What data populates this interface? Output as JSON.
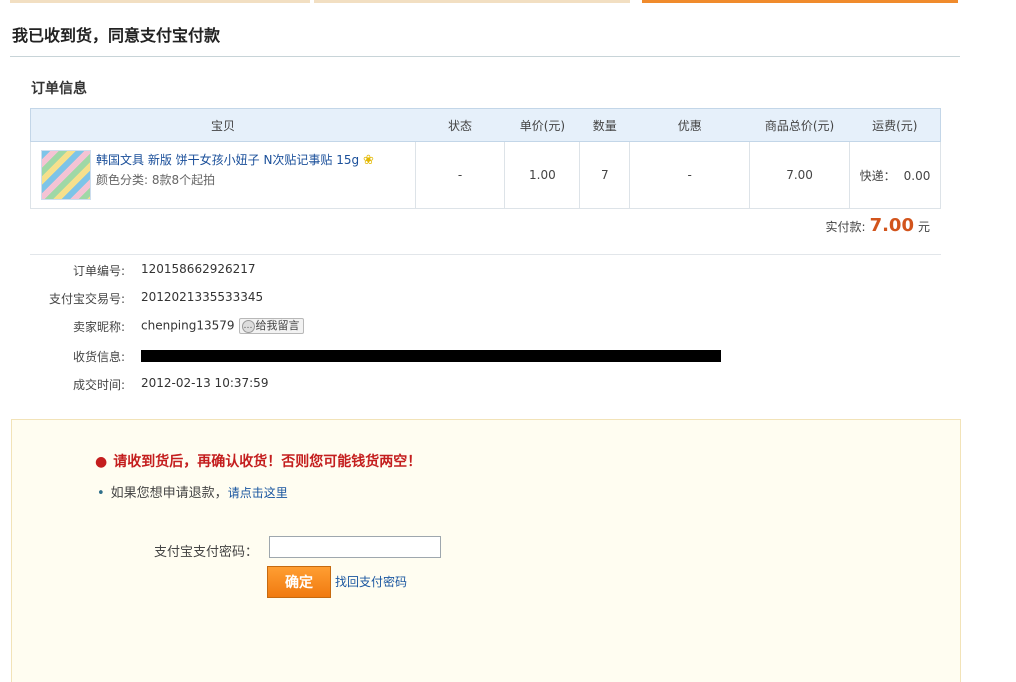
{
  "page": {
    "title": "我已收到货，同意支付宝付款"
  },
  "order_info": {
    "section_title": "订单信息",
    "columns": [
      "宝贝",
      "状态",
      "单价(元)",
      "数量",
      "优惠",
      "商品总价(元)",
      "运费(元)"
    ],
    "item": {
      "title": "韩国文具 新版 饼干女孩小妞子 N次贴记事贴 15g",
      "sku": "颜色分类: 8款8个起拍",
      "status": "-",
      "unit_price": "1.00",
      "quantity": "7",
      "discount": "-",
      "total": "7.00",
      "shipping_label": "快递：",
      "shipping_value": "0.00"
    },
    "paid_label": "实付款:",
    "paid_amount": "7.00",
    "paid_unit": "元"
  },
  "details": {
    "order_no_label": "订单编号:",
    "order_no": "120158662926217",
    "alipay_no_label": "支付宝交易号:",
    "alipay_no": "2012021335533345",
    "seller_label": "卖家昵称:",
    "seller": "chenping13579",
    "message_button": "给我留言",
    "shipping_info_label": "收货信息:",
    "deal_time_label": "成交时间:",
    "deal_time": "2012-02-13 10:37:59"
  },
  "confirm": {
    "warning": "请收到货后，再确认收货！否则您可能钱货两空！",
    "refund_text": "如果您想申请退款，",
    "refund_link": "请点击这里",
    "password_label": "支付宝支付密码：",
    "password_value": "",
    "ok_button": "确定",
    "forgot_link": "找回支付密码"
  },
  "colors": {
    "accent_orange": "#f08b2c",
    "price_orange": "#d2541c",
    "warning_red": "#c41e1e",
    "link_blue": "#1a56a0"
  }
}
